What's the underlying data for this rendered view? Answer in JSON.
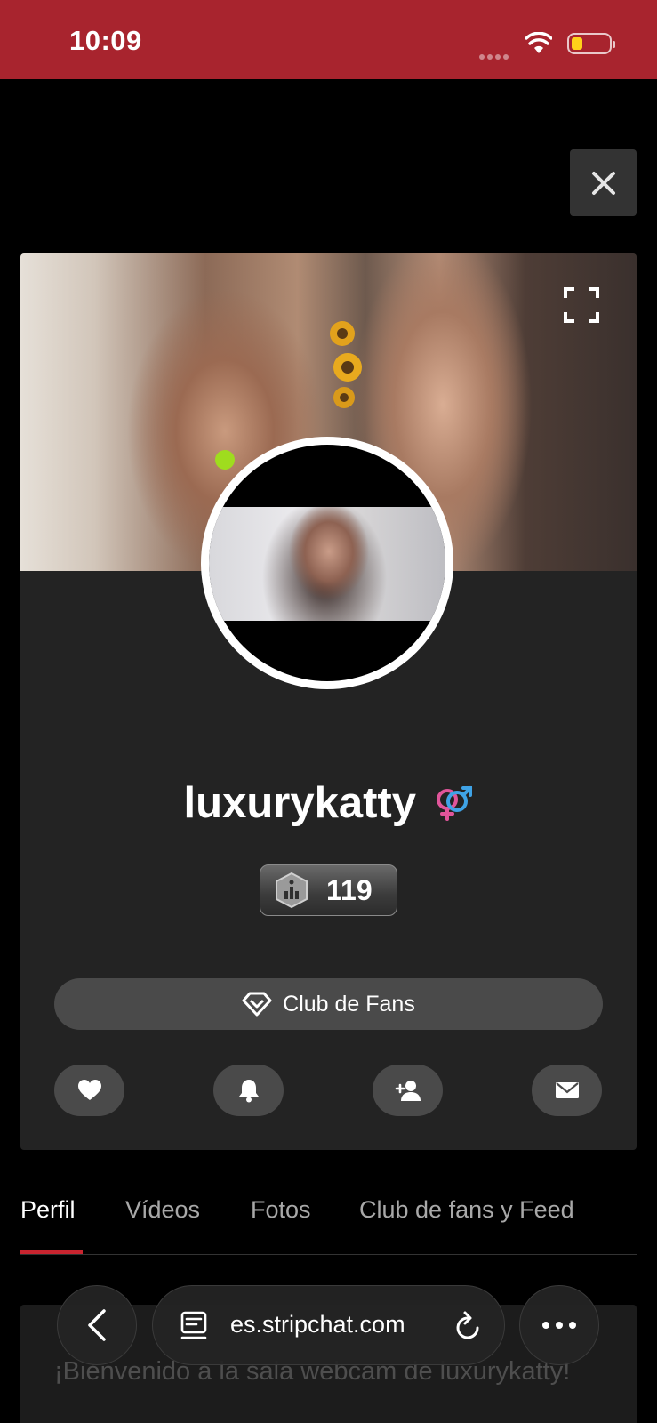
{
  "status_bar": {
    "time": "10:09"
  },
  "profile": {
    "username": "luxurykatty",
    "level": "119",
    "online": true,
    "gender_icon": "couple-gender-icon"
  },
  "fan_club_button": {
    "label": "Club de Fans",
    "icon": "diamond-icon"
  },
  "actions": [
    {
      "name": "favorite",
      "icon": "heart-icon"
    },
    {
      "name": "notify",
      "icon": "bell-icon"
    },
    {
      "name": "follow",
      "icon": "add-user-icon"
    },
    {
      "name": "message",
      "icon": "envelope-icon"
    }
  ],
  "tabs": [
    {
      "label": "Perfil",
      "active": true
    },
    {
      "label": "Vídeos",
      "active": false
    },
    {
      "label": "Fotos",
      "active": false
    },
    {
      "label": "Club de fans y Feed",
      "active": false
    }
  ],
  "welcome_text": "¡Bienvenido a la sala webcam de luxurykatty!",
  "browser": {
    "url": "es.stripchat.com"
  },
  "colors": {
    "status_bar": "#a8242e",
    "tab_indicator": "#c8242f",
    "online_dot": "#9fdc1e"
  }
}
